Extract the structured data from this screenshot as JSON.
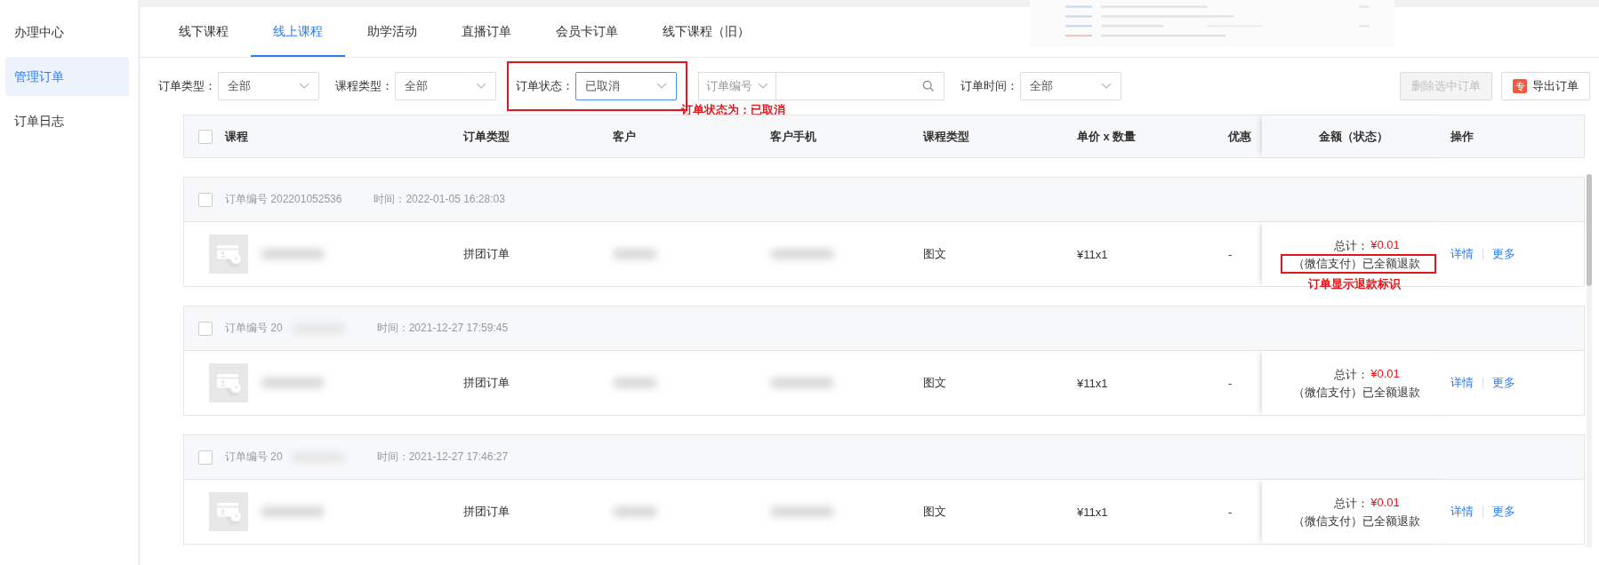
{
  "sidebar": {
    "items": [
      {
        "label": "办理中心",
        "selected": false
      },
      {
        "label": "管理订单",
        "selected": true
      },
      {
        "label": "订单日志",
        "selected": false
      }
    ]
  },
  "tabs": [
    {
      "label": "线下课程",
      "selected": false
    },
    {
      "label": "线上课程",
      "selected": true
    },
    {
      "label": "助学活动",
      "selected": false
    },
    {
      "label": "直播订单",
      "selected": false
    },
    {
      "label": "会员卡订单",
      "selected": false
    },
    {
      "label": "线下课程（旧）",
      "selected": false
    }
  ],
  "filters": [
    {
      "label": "订单类型：",
      "value": "全部",
      "highlighted": false
    },
    {
      "label": "课程类型：",
      "value": "全部",
      "highlighted": false
    },
    {
      "label": "订单状态：",
      "value": "已取消",
      "highlighted": true
    }
  ],
  "search": {
    "field": "订单编号"
  },
  "time_filter": {
    "label": "订单时间：",
    "value": "全部"
  },
  "buttons": [
    {
      "kind": "plain",
      "label": "删除选中订单",
      "disabled": true
    },
    {
      "kind": "export",
      "label": "导出订单",
      "badge": "专",
      "disabled": false
    }
  ],
  "filter_annotation": "订单状态为：已取消",
  "table": {
    "all_checked": false,
    "columns": [
      "课程",
      "订单类型",
      "客户",
      "客户手机",
      "课程类型",
      "单价 x 数量",
      "优惠",
      "金额（状态）",
      "操作"
    ],
    "orders": [
      {
        "checked": false,
        "number": "订单编号 202201052536",
        "time": "时间：2022-01-05 16:28:03",
        "order_type": "拼团订单",
        "course_type": "图文",
        "price": "¥11x1",
        "discount": "-",
        "total_label": "总计：",
        "total": "¥0.01",
        "status": "（微信支付）已全额退款",
        "highlighted": true,
        "annotation": "订单显示退款标识",
        "actions": [
          "详情",
          "更多"
        ]
      },
      {
        "checked": false,
        "number": "订单编号 20",
        "time": "时间：2021-12-27 17:59:45",
        "order_type": "拼团订单",
        "course_type": "图文",
        "price": "¥11x1",
        "discount": "-",
        "total_label": "总计：",
        "total": "¥0.01",
        "status": "（微信支付）已全额退款",
        "highlighted": false,
        "actions": [
          "详情",
          "更多"
        ]
      },
      {
        "checked": false,
        "number": "订单编号 20",
        "time": "时间：2021-12-27 17:46:27",
        "order_type": "拼团订单",
        "course_type": "图文",
        "price": "¥11x1",
        "discount": "-",
        "total_label": "总计：",
        "total": "¥0.01",
        "status": "（微信支付）已全额退款",
        "highlighted": false,
        "actions": [
          "详情",
          "更多"
        ]
      }
    ]
  }
}
